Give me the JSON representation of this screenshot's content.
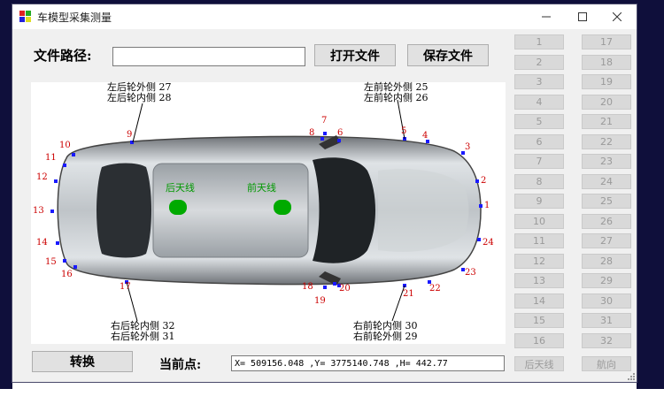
{
  "window": {
    "title": "车模型采集测量"
  },
  "controls": {
    "path_label": "文件路径:",
    "path_value": "",
    "open_button": "打开文件",
    "save_button": "保存文件",
    "convert_button": "转换",
    "current_point_label": "当前点:",
    "coordinates": "X= 509156.048 ,Y= 3775140.748 ,H= 442.77"
  },
  "car_labels": {
    "left_rear": [
      "左后轮外侧 27",
      "左后轮内侧 28"
    ],
    "left_front": [
      "左前轮外侧 25",
      "左前轮内侧 26"
    ],
    "right_rear": [
      "右后轮内侧 32",
      "右后轮外侧 31"
    ],
    "right_front": [
      "右前轮内侧 30",
      "右前轮外侧 29"
    ],
    "rear_antenna": "后天线",
    "front_antenna": "前天线"
  },
  "points": [
    "1",
    "2",
    "3",
    "4",
    "5",
    "6",
    "7",
    "8",
    "9",
    "10",
    "11",
    "12",
    "13",
    "14",
    "15",
    "16",
    "17",
    "18",
    "19",
    "20",
    "21",
    "22",
    "23",
    "24"
  ],
  "grid_left": [
    "1",
    "2",
    "3",
    "4",
    "5",
    "6",
    "7",
    "8",
    "9",
    "10",
    "11",
    "12",
    "13",
    "14",
    "15",
    "16"
  ],
  "grid_right": [
    "17",
    "18",
    "19",
    "20",
    "21",
    "22",
    "23",
    "24",
    "25",
    "26",
    "27",
    "28",
    "29",
    "30",
    "31",
    "32"
  ],
  "bottom_buttons": {
    "rear_antenna": "后天线",
    "heading": "航向"
  },
  "colors": {
    "point_marker": "#1a1aff",
    "antenna": "#00aa00",
    "label_red": "#cc0000"
  }
}
